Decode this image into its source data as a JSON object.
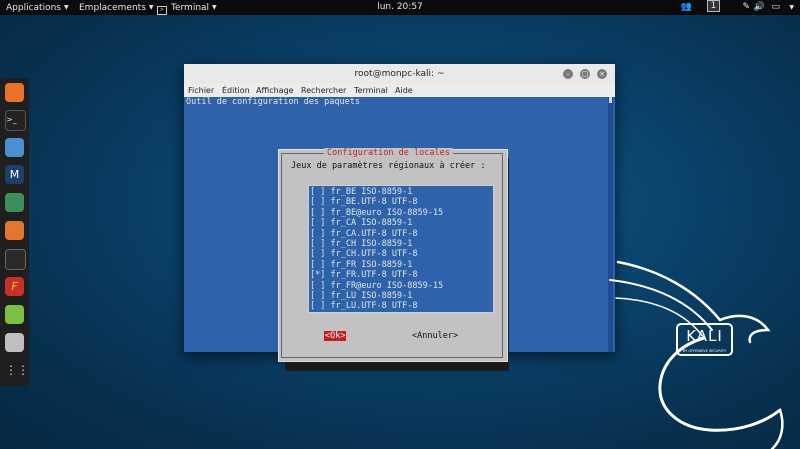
{
  "topbar": {
    "applications": "Applications",
    "emplacements": "Emplacements",
    "terminal": "Terminal",
    "clock": "lun. 20:57",
    "workspace": "1"
  },
  "dock": {
    "apps": [
      {
        "name": "firefox-icon",
        "color": "#e8722a"
      },
      {
        "name": "terminal-app-icon",
        "color": "#222222"
      },
      {
        "name": "files-icon",
        "color": "#4a8fd0"
      },
      {
        "name": "metasploit-icon",
        "color": "#1d3f6e"
      },
      {
        "name": "armitage-icon",
        "color": "#3c8e5a"
      },
      {
        "name": "burpsuite-icon",
        "color": "#e2782d"
      },
      {
        "name": "beef-icon",
        "color": "#1e1e1e"
      },
      {
        "name": "faraday-icon",
        "color": "#c9302c"
      },
      {
        "name": "leafpad-icon",
        "color": "#7bc043"
      },
      {
        "name": "screenshot-icon",
        "color": "#bfbfbf"
      },
      {
        "name": "show-apps-icon",
        "color": "#1f1f1f"
      }
    ]
  },
  "window": {
    "title": "root@monpc-kali: ~",
    "menu": [
      "Fichier",
      "Édition",
      "Affichage",
      "Rechercher",
      "Terminal",
      "Aide"
    ]
  },
  "terminal": {
    "header": "Outil de configuration des paquets"
  },
  "dialog": {
    "title": "Configuration de locales",
    "prompt": "Jeux de paramètres régionaux à créer :",
    "items": [
      {
        "mark": "[ ]",
        "label": "fr_BE ISO-8859-1"
      },
      {
        "mark": "[ ]",
        "label": "fr_BE.UTF-8 UTF-8"
      },
      {
        "mark": "[ ]",
        "label": "fr_BE@euro ISO-8859-15"
      },
      {
        "mark": "[ ]",
        "label": "fr_CA ISO-8859-1"
      },
      {
        "mark": "[ ]",
        "label": "fr_CA.UTF-8 UTF-8"
      },
      {
        "mark": "[ ]",
        "label": "fr_CH ISO-8859-1"
      },
      {
        "mark": "[ ]",
        "label": "fr_CH.UTF-8 UTF-8"
      },
      {
        "mark": "[ ]",
        "label": "fr_FR ISO-8859-1"
      },
      {
        "mark": "[*]",
        "label": "fr_FR.UTF-8 UTF-8"
      },
      {
        "mark": "[ ]",
        "label": "fr_FR@euro ISO-8859-15"
      },
      {
        "mark": "[ ]",
        "label": "fr_LU ISO-8859-1"
      },
      {
        "mark": "[ ]",
        "label": "fr_LU.UTF-8 UTF-8"
      }
    ],
    "ok": "<Ok>",
    "cancel": "<Annuler>"
  },
  "wallpaper": {
    "logo_text": "KALI",
    "logo_sub": "BY OFFENSIVE SECURITY"
  },
  "colors": {
    "accent_red": "#c81e1e",
    "terminal_blue": "#2e63ab",
    "dialog_gray": "#c2c2c2"
  }
}
